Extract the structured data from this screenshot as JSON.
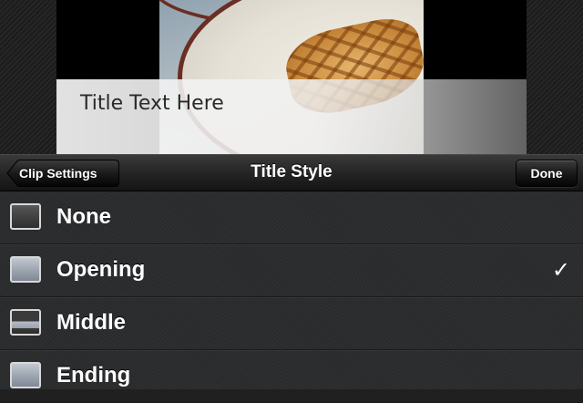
{
  "preview": {
    "title_text": "Title Text Here"
  },
  "navbar": {
    "back_label": "Clip Settings",
    "title": "Title Style",
    "done_label": "Done"
  },
  "styles": [
    {
      "label": "None",
      "selected": false
    },
    {
      "label": "Opening",
      "selected": true
    },
    {
      "label": "Middle",
      "selected": false
    },
    {
      "label": "Ending",
      "selected": false
    }
  ],
  "selected_mark": "✓",
  "colors": {
    "list_background": "#2b2c2e",
    "navbar_background": "#252525",
    "text": "#ffffff"
  }
}
